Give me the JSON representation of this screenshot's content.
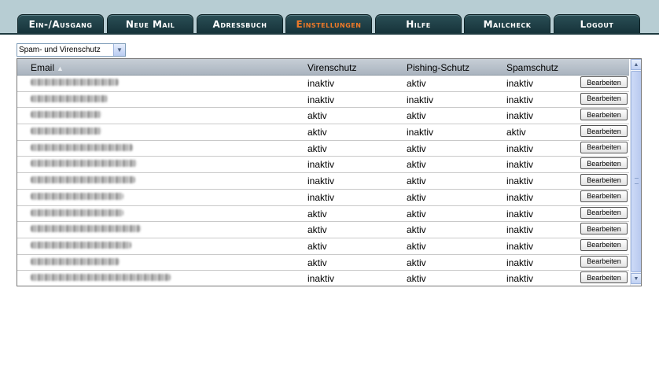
{
  "nav": {
    "tabs": [
      {
        "label": "Ein-/Ausgang",
        "active": false
      },
      {
        "label": "Neue Mail",
        "active": false
      },
      {
        "label": "Adressbuch",
        "active": false
      },
      {
        "label": "Einstellungen",
        "active": true
      },
      {
        "label": "Hilfe",
        "active": false
      },
      {
        "label": "Mailcheck",
        "active": false
      },
      {
        "label": "Logout",
        "active": false
      }
    ],
    "active_color": "#f07a28",
    "tab_color": "#1f4047"
  },
  "filter": {
    "selected": "Spam- und Virenschutz"
  },
  "grid": {
    "columns": {
      "email": "Email",
      "virus": "Virenschutz",
      "phishing": "Pishing-Schutz",
      "spam": "Spamschutz"
    },
    "button_label": "Bearbeiten",
    "rows": [
      {
        "virus": "inaktiv",
        "phishing": "aktiv",
        "spam": "inaktiv"
      },
      {
        "virus": "inaktiv",
        "phishing": "inaktiv",
        "spam": "inaktiv"
      },
      {
        "virus": "aktiv",
        "phishing": "aktiv",
        "spam": "inaktiv"
      },
      {
        "virus": "aktiv",
        "phishing": "inaktiv",
        "spam": "aktiv"
      },
      {
        "virus": "aktiv",
        "phishing": "aktiv",
        "spam": "inaktiv"
      },
      {
        "virus": "inaktiv",
        "phishing": "aktiv",
        "spam": "inaktiv"
      },
      {
        "virus": "inaktiv",
        "phishing": "aktiv",
        "spam": "inaktiv"
      },
      {
        "virus": "inaktiv",
        "phishing": "aktiv",
        "spam": "inaktiv"
      },
      {
        "virus": "aktiv",
        "phishing": "aktiv",
        "spam": "inaktiv"
      },
      {
        "virus": "aktiv",
        "phishing": "aktiv",
        "spam": "inaktiv"
      },
      {
        "virus": "aktiv",
        "phishing": "aktiv",
        "spam": "inaktiv"
      },
      {
        "virus": "aktiv",
        "phishing": "aktiv",
        "spam": "inaktiv"
      },
      {
        "virus": "inaktiv",
        "phishing": "aktiv",
        "spam": "inaktiv"
      }
    ]
  }
}
